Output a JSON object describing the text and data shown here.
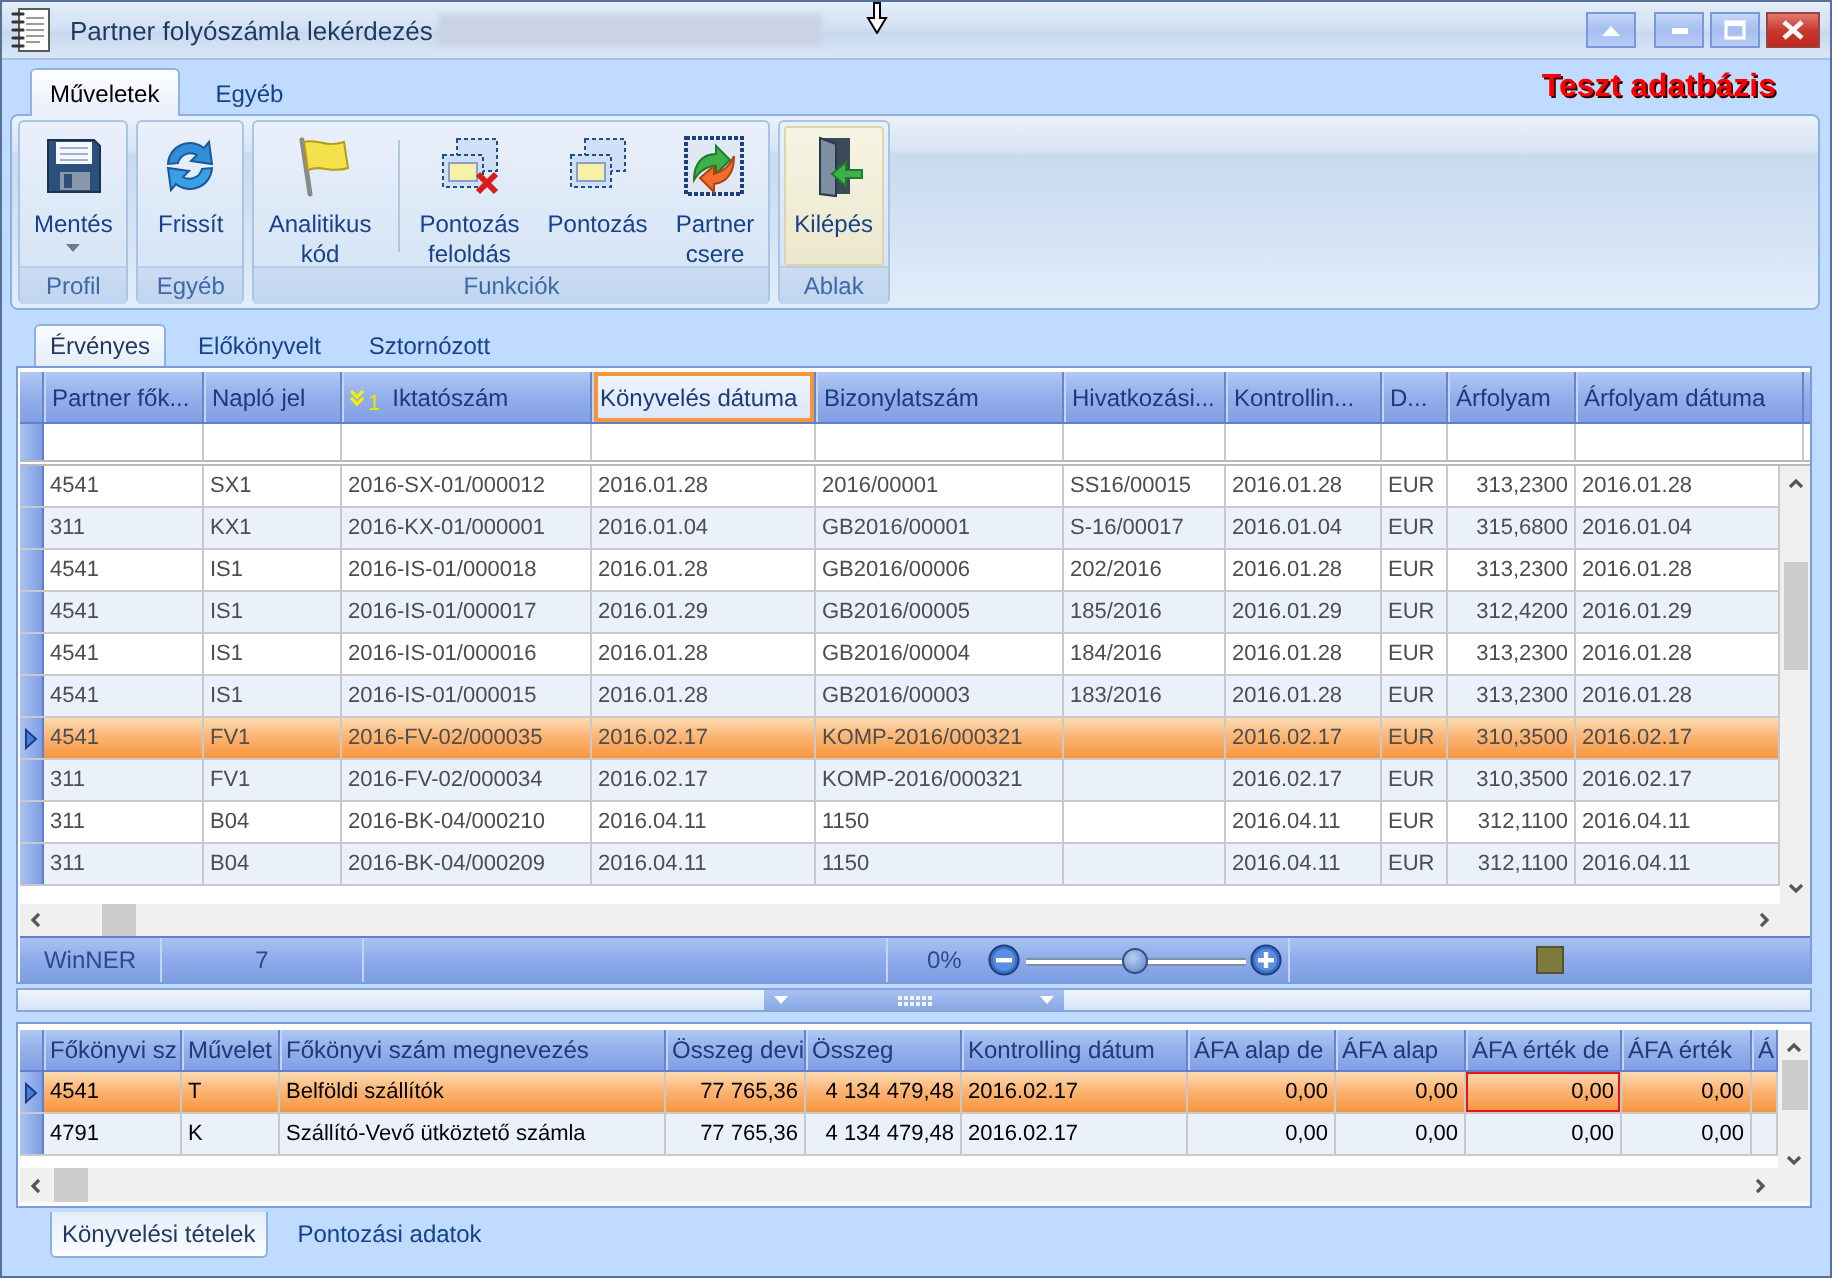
{
  "window": {
    "title": "Partner folyószámla lekérdezés"
  },
  "ribbon": {
    "tabs": [
      {
        "label": "Műveletek",
        "selected": true
      },
      {
        "label": "Egyéb",
        "selected": false
      }
    ],
    "notice": "Teszt adatbázis",
    "groups": [
      {
        "label": "Profil",
        "buttons": [
          {
            "label": "Mentés",
            "dropdown": true,
            "highlighted": false,
            "separator_after": false
          }
        ]
      },
      {
        "label": "Egyéb",
        "buttons": [
          {
            "label": "Frissít",
            "dropdown": false,
            "highlighted": false,
            "separator_after": false
          }
        ]
      },
      {
        "label": "Funkciók",
        "buttons": [
          {
            "label": "Analitikus kód",
            "dropdown": false,
            "highlighted": false,
            "separator_after": true
          },
          {
            "label": "Pontozás feloldás",
            "dropdown": false,
            "highlighted": false,
            "separator_after": false
          },
          {
            "label": "Pontozás",
            "dropdown": false,
            "highlighted": false,
            "separator_after": false
          },
          {
            "label": "Partner csere",
            "dropdown": false,
            "highlighted": false,
            "separator_after": false
          }
        ]
      },
      {
        "label": "Ablak",
        "buttons": [
          {
            "label": "Kilépés",
            "dropdown": false,
            "highlighted": true,
            "separator_after": false
          }
        ]
      }
    ]
  },
  "record_tabs": [
    {
      "label": "Érvényes",
      "selected": true
    },
    {
      "label": "Előkönyvelt",
      "selected": false
    },
    {
      "label": "Sztornózott",
      "selected": false
    }
  ],
  "upper_grid": {
    "columns": [
      {
        "label": "Partner fők...",
        "hovered": false
      },
      {
        "label": "Napló jel",
        "hovered": false
      },
      {
        "label": "Iktatószám",
        "hovered": false,
        "sort_rank": "1"
      },
      {
        "label": "Könyvelés dátuma",
        "hovered": true
      },
      {
        "label": "Bizonylatszám",
        "hovered": false
      },
      {
        "label": "Hivatkozási...",
        "hovered": false
      },
      {
        "label": "Kontrollin...",
        "hovered": false
      },
      {
        "label": "D...",
        "hovered": false
      },
      {
        "label": "Árfolyam",
        "hovered": false
      },
      {
        "label": "Árfolyam dátuma",
        "hovered": false
      }
    ],
    "rows": [
      {
        "selected": false,
        "cells": [
          "4541",
          "SX1",
          "2016-SX-01/000012",
          "2016.01.28",
          "2016/00001",
          "SS16/00015",
          "2016.01.28",
          "EUR",
          "313,2300",
          "2016.01.28"
        ]
      },
      {
        "selected": false,
        "cells": [
          "311",
          "KX1",
          "2016-KX-01/000001",
          "2016.01.04",
          "GB2016/00001",
          "S-16/00017",
          "2016.01.04",
          "EUR",
          "315,6800",
          "2016.01.04"
        ]
      },
      {
        "selected": false,
        "cells": [
          "4541",
          "IS1",
          "2016-IS-01/000018",
          "2016.01.28",
          "GB2016/00006",
          "202/2016",
          "2016.01.28",
          "EUR",
          "313,2300",
          "2016.01.28"
        ]
      },
      {
        "selected": false,
        "cells": [
          "4541",
          "IS1",
          "2016-IS-01/000017",
          "2016.01.29",
          "GB2016/00005",
          "185/2016",
          "2016.01.29",
          "EUR",
          "312,4200",
          "2016.01.29"
        ]
      },
      {
        "selected": false,
        "cells": [
          "4541",
          "IS1",
          "2016-IS-01/000016",
          "2016.01.28",
          "GB2016/00004",
          "184/2016",
          "2016.01.28",
          "EUR",
          "313,2300",
          "2016.01.28"
        ]
      },
      {
        "selected": false,
        "cells": [
          "4541",
          "IS1",
          "2016-IS-01/000015",
          "2016.01.28",
          "GB2016/00003",
          "183/2016",
          "2016.01.28",
          "EUR",
          "313,2300",
          "2016.01.28"
        ]
      },
      {
        "selected": true,
        "cells": [
          "4541",
          "FV1",
          "2016-FV-02/000035",
          "2016.02.17",
          "KOMP-2016/000321",
          null,
          "2016.02.17",
          "EUR",
          "310,3500",
          "2016.02.17"
        ]
      },
      {
        "selected": false,
        "cells": [
          "311",
          "FV1",
          "2016-FV-02/000034",
          "2016.02.17",
          "KOMP-2016/000321",
          null,
          "2016.02.17",
          "EUR",
          "310,3500",
          "2016.02.17"
        ]
      },
      {
        "selected": false,
        "cells": [
          "311",
          "B04",
          "2016-BK-04/000210",
          "2016.04.11",
          "1150",
          null,
          "2016.04.11",
          "EUR",
          "312,1100",
          "2016.04.11"
        ]
      },
      {
        "selected": false,
        "cells": [
          "311",
          "B04",
          "2016-BK-04/000209",
          "2016.04.11",
          "1150",
          null,
          "2016.04.11",
          "EUR",
          "312,1100",
          "2016.04.11"
        ]
      }
    ],
    "status_bar": {
      "source": "WinNER",
      "count": "7",
      "zoom": {
        "reading": "0%",
        "level": 0.5
      }
    }
  },
  "lower_grid": {
    "columns": [
      {
        "label": "Főkönyvi sz",
        "focused": false
      },
      {
        "label": "Művelet",
        "focused": false
      },
      {
        "label": "Főkönyvi szám megnevezés",
        "focused": false
      },
      {
        "label": "Összeg devi",
        "focused": false
      },
      {
        "label": "Összeg",
        "focused": false
      },
      {
        "label": "Kontrolling dátum",
        "focused": false
      },
      {
        "label": "ÁFA alap de",
        "focused": false
      },
      {
        "label": "ÁFA alap",
        "focused": false
      },
      {
        "label": "ÁFA érték de",
        "focused": true
      },
      {
        "label": "ÁFA érték",
        "focused": false
      },
      {
        "label": "Á",
        "focused": false
      }
    ],
    "rows": [
      {
        "selected": true,
        "cells": [
          "4541",
          "T",
          "Belföldi szállítók",
          "77 765,36",
          "4 134 479,48",
          "2016.02.17",
          "0,00",
          "0,00",
          "0,00",
          "0,00"
        ]
      },
      {
        "selected": false,
        "cells": [
          "4791",
          "K",
          "Szállító-Vevő ütköztető számla",
          "77 765,36",
          "4 134 479,48",
          "2016.02.17",
          "0,00",
          "0,00",
          "0,00",
          "0,00"
        ]
      }
    ]
  },
  "detail_tabs": [
    {
      "label": "Könyvelési tételek",
      "selected": true
    },
    {
      "label": "Pontozási adatok",
      "selected": false
    }
  ]
}
